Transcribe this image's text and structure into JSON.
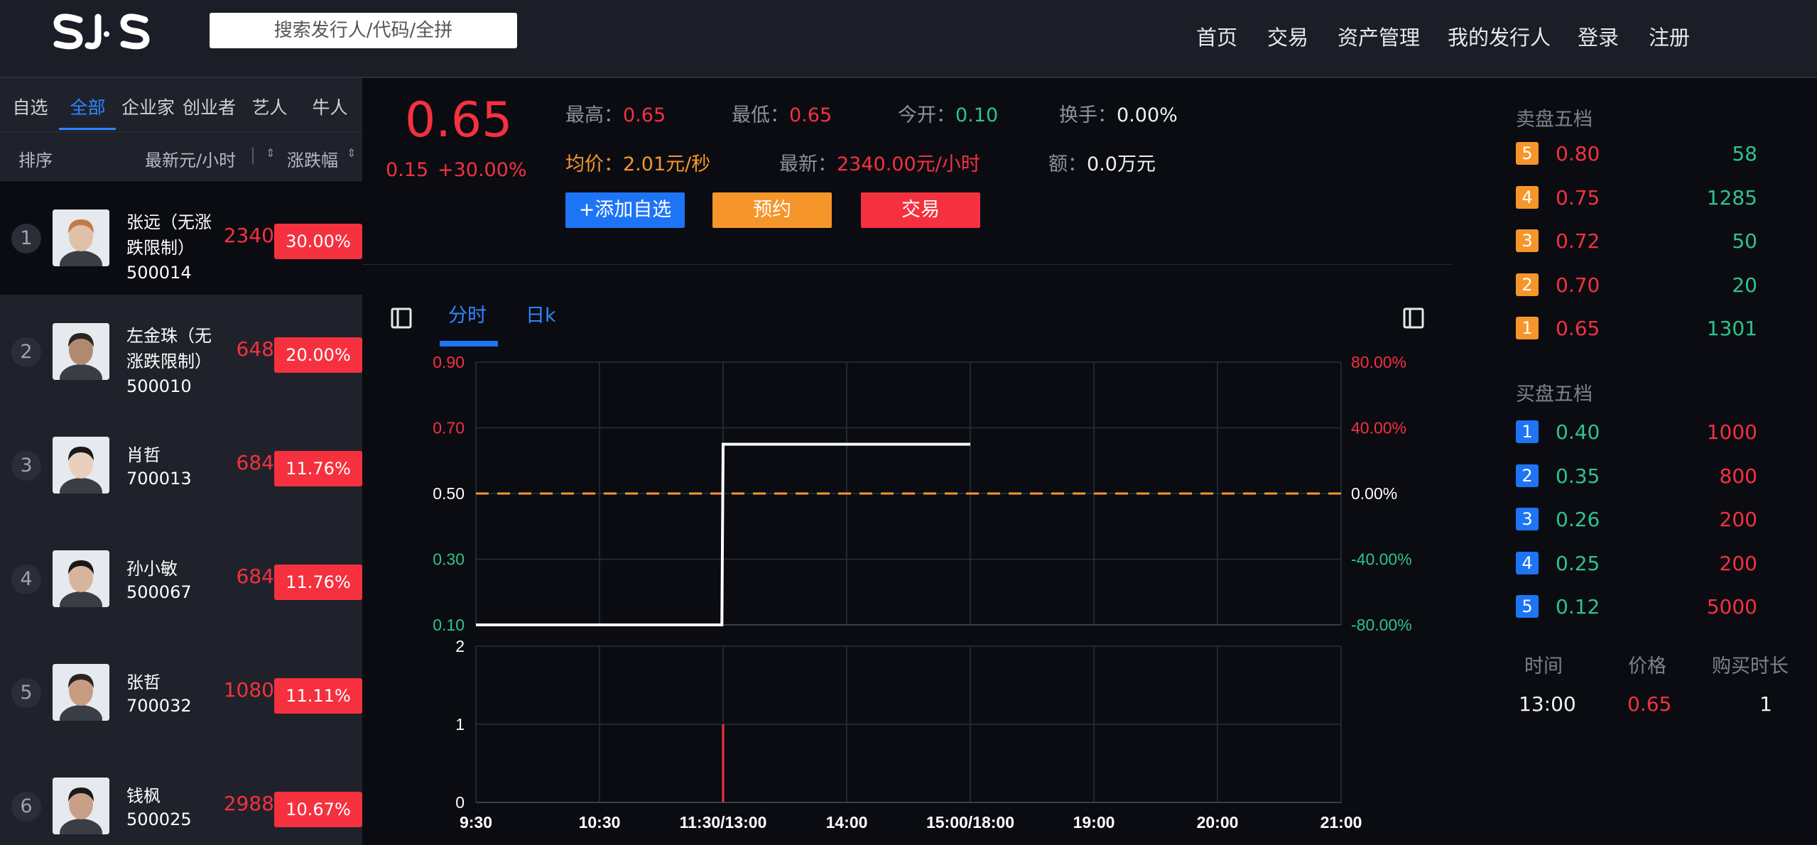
{
  "header": {
    "logo_text": "SJS",
    "search_placeholder": "搜索发行人/代码/全拼",
    "nav": [
      "首页",
      "交易",
      "资产管理",
      "我的发行人",
      "登录",
      "注册"
    ]
  },
  "sidebar": {
    "tabs": [
      "自选",
      "全部",
      "企业家",
      "创业者",
      "艺人",
      "牛人"
    ],
    "active_tab": "全部",
    "sort": {
      "label": "排序",
      "price_col": "最新元/小时",
      "change_col": "涨跌幅"
    },
    "rows": [
      {
        "rank": "1",
        "name": "张远（无涨跌限制）",
        "code": "500014",
        "price": "2340",
        "change": "30.00%"
      },
      {
        "rank": "2",
        "name": "左金珠（无涨跌限制）",
        "code": "500010",
        "price": "648",
        "change": "20.00%"
      },
      {
        "rank": "3",
        "name": "肖哲",
        "code": "700013",
        "price": "684",
        "change": "11.76%"
      },
      {
        "rank": "4",
        "name": "孙小敏",
        "code": "500067",
        "price": "684",
        "change": "11.76%"
      },
      {
        "rank": "5",
        "name": "张哲",
        "code": "700032",
        "price": "1080",
        "change": "11.11%"
      },
      {
        "rank": "6",
        "name": "钱枫",
        "code": "500025",
        "price": "2988",
        "change": "10.67%"
      }
    ]
  },
  "quote": {
    "price": "0.65",
    "change": "0.15",
    "change_pct": "+30.00%",
    "high_label": "最高：",
    "high": "0.65",
    "low_label": "最低：",
    "low": "0.65",
    "open_label": "今开：",
    "open": "0.10",
    "turnover_label": "换手：",
    "turnover": "0.00%",
    "avg_label": "均价：",
    "avg": "2.01元/秒",
    "latest_label": "最新：",
    "latest": "2340.00元/小时",
    "amount_label": "额：",
    "amount": "0.0万元",
    "btn_watch": "+添加自选",
    "btn_reserve": "预约",
    "btn_trade": "交易"
  },
  "chart_tabs": [
    "分时",
    "日k"
  ],
  "chart_data": {
    "type": "line",
    "x_ticks": [
      "9:30",
      "10:30",
      "11:30/13:00",
      "14:00",
      "15:00/18:00",
      "19:00",
      "20:00",
      "21:00"
    ],
    "y_ticks": [
      "0.90",
      "0.70",
      "0.50",
      "0.30",
      "0.10"
    ],
    "y_right_ticks": [
      "80.00%",
      "40.00%",
      "0.00%",
      "-40.00%",
      "-80.00%"
    ],
    "ylim": [
      0.1,
      0.9
    ],
    "reference": 0.5,
    "x_index": [
      0,
      1.99,
      2.0,
      4.0
    ],
    "price": [
      0.1,
      0.1,
      0.65,
      0.65
    ],
    "volume": {
      "y_ticks": [
        "2",
        "1",
        "0"
      ],
      "ylim": [
        0,
        2
      ],
      "x_index": [
        2.0
      ],
      "values": [
        1
      ]
    },
    "colors": {
      "price_line": "#ffffff",
      "reference": "#f6962a",
      "up": "#f5313f",
      "down": "#30c389"
    }
  },
  "orderbook": {
    "sell_title": "卖盘五档",
    "sell": [
      {
        "level": "5",
        "price": "0.80",
        "volume": "58"
      },
      {
        "level": "4",
        "price": "0.75",
        "volume": "1285"
      },
      {
        "level": "3",
        "price": "0.72",
        "volume": "50"
      },
      {
        "level": "2",
        "price": "0.70",
        "volume": "20"
      },
      {
        "level": "1",
        "price": "0.65",
        "volume": "1301"
      }
    ],
    "buy_title": "买盘五档",
    "buy": [
      {
        "level": "1",
        "price": "0.40",
        "volume": "1000"
      },
      {
        "level": "2",
        "price": "0.35",
        "volume": "800"
      },
      {
        "level": "3",
        "price": "0.26",
        "volume": "200"
      },
      {
        "level": "4",
        "price": "0.25",
        "volume": "200"
      },
      {
        "level": "5",
        "price": "0.12",
        "volume": "5000"
      }
    ],
    "trades_header": [
      "时间",
      "价格",
      "购买时长"
    ],
    "trades": [
      {
        "time": "13:00",
        "price": "0.65",
        "duration": "1"
      }
    ]
  }
}
